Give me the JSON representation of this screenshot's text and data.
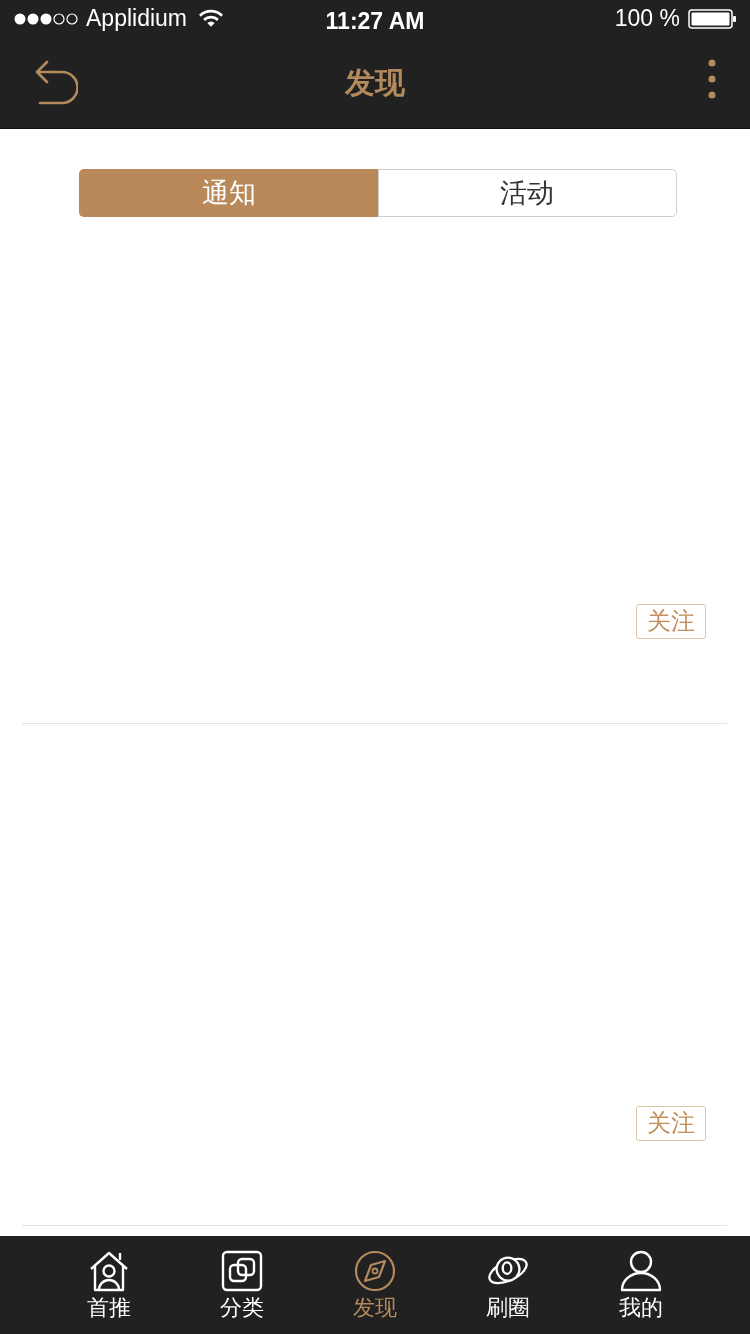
{
  "status_bar": {
    "carrier": "Applidium",
    "time": "11:27 AM",
    "battery": "100 %"
  },
  "nav_bar": {
    "title": "发现"
  },
  "segments": [
    {
      "label": "通知",
      "selected": true
    },
    {
      "label": "活动",
      "selected": false
    }
  ],
  "feed": [
    {
      "follow_button": "关注"
    },
    {
      "follow_button": "关注"
    }
  ],
  "tab_bar": [
    {
      "label": "首推",
      "selected": false
    },
    {
      "label": "分类",
      "selected": false
    },
    {
      "label": "发现",
      "selected": true
    },
    {
      "label": "刷圈",
      "selected": false
    },
    {
      "label": "我的",
      "selected": false
    }
  ]
}
